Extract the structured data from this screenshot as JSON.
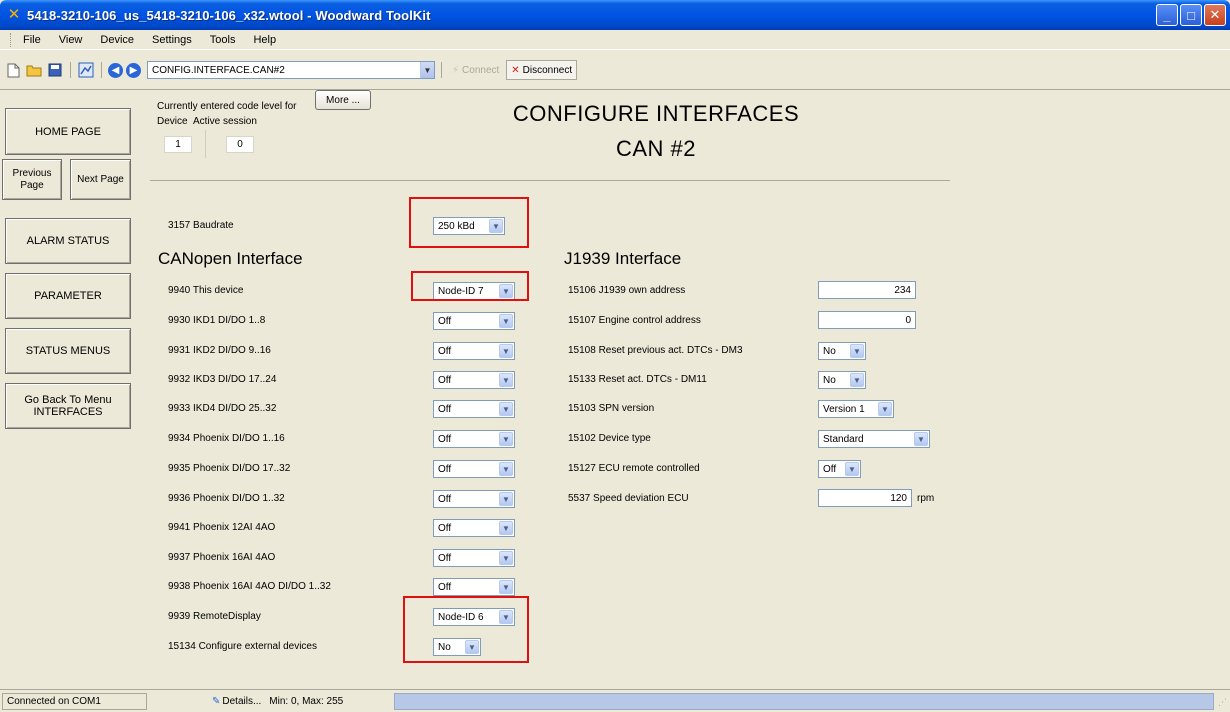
{
  "window": {
    "title": "5418-3210-106_us_5418-3210-106_x32.wtool - Woodward ToolKit",
    "controls": [
      "_",
      "□",
      "✕"
    ]
  },
  "menu": [
    "File",
    "View",
    "Device",
    "Settings",
    "Tools",
    "Help"
  ],
  "toolbar": {
    "address": "CONFIG.INTERFACE.CAN#2",
    "connect_label": "Connect",
    "disconnect_label": "Disconnect"
  },
  "nav": {
    "home": "HOME PAGE",
    "previous": "Previous Page",
    "next": "Next Page",
    "alarm": "ALARM STATUS",
    "parameter": "PARAMETER",
    "status_menus": "STATUS MENUS",
    "go_back": "Go Back To Menu INTERFACES"
  },
  "code_level": {
    "caption": "Currently entered code level for",
    "more_label": "More ...",
    "device_label": "Device",
    "session_label": "Active session",
    "device_value": "1",
    "session_value": "0"
  },
  "page": {
    "title": "CONFIGURE INTERFACES",
    "subtitle": "CAN #2"
  },
  "baudrate": {
    "label": "3157 Baudrate",
    "value": "250 kBd"
  },
  "canopen": {
    "heading": "CANopen Interface",
    "rows": [
      {
        "label": "9940 This device",
        "value": "Node-ID 7"
      },
      {
        "label": "9930 IKD1 DI/DO 1..8",
        "value": "Off"
      },
      {
        "label": "9931 IKD2 DI/DO 9..16",
        "value": "Off"
      },
      {
        "label": "9932 IKD3 DI/DO 17..24",
        "value": "Off"
      },
      {
        "label": "9933 IKD4 DI/DO 25..32",
        "value": "Off"
      },
      {
        "label": "9934 Phoenix DI/DO 1..16",
        "value": "Off"
      },
      {
        "label": "9935 Phoenix DI/DO 17..32",
        "value": "Off"
      },
      {
        "label": "9936 Phoenix DI/DO 1..32",
        "value": "Off"
      },
      {
        "label": "9941 Phoenix 12AI 4AO",
        "value": "Off"
      },
      {
        "label": "9937 Phoenix 16AI 4AO",
        "value": "Off"
      },
      {
        "label": "9938 Phoenix 16AI 4AO DI/DO 1..32",
        "value": "Off"
      },
      {
        "label": "9939 RemoteDisplay",
        "value": "Node-ID 6"
      },
      {
        "label": "15134 Configure external devices",
        "value": "No"
      }
    ]
  },
  "j1939": {
    "heading": "J1939 Interface",
    "rows": [
      {
        "label": "15106 J1939 own address",
        "value": "234"
      },
      {
        "label": "15107 Engine control address",
        "value": "0"
      },
      {
        "label": "15108 Reset previous act. DTCs - DM3",
        "value": "No"
      },
      {
        "label": "15133 Reset act. DTCs - DM11",
        "value": "No"
      },
      {
        "label": "15103 SPN version",
        "value": "Version 1"
      },
      {
        "label": "15102 Device type",
        "value": "Standard"
      },
      {
        "label": "15127 ECU remote controlled",
        "value": "Off"
      },
      {
        "label": "5537 Speed deviation ECU",
        "value": "120",
        "unit": "rpm"
      }
    ]
  },
  "status": {
    "connection": "Connected on COM1",
    "details": "Details...",
    "range": "Min: 0, Max: 255"
  },
  "colors": {
    "highlight": "#e01010",
    "titlebar": "#0054e3"
  }
}
